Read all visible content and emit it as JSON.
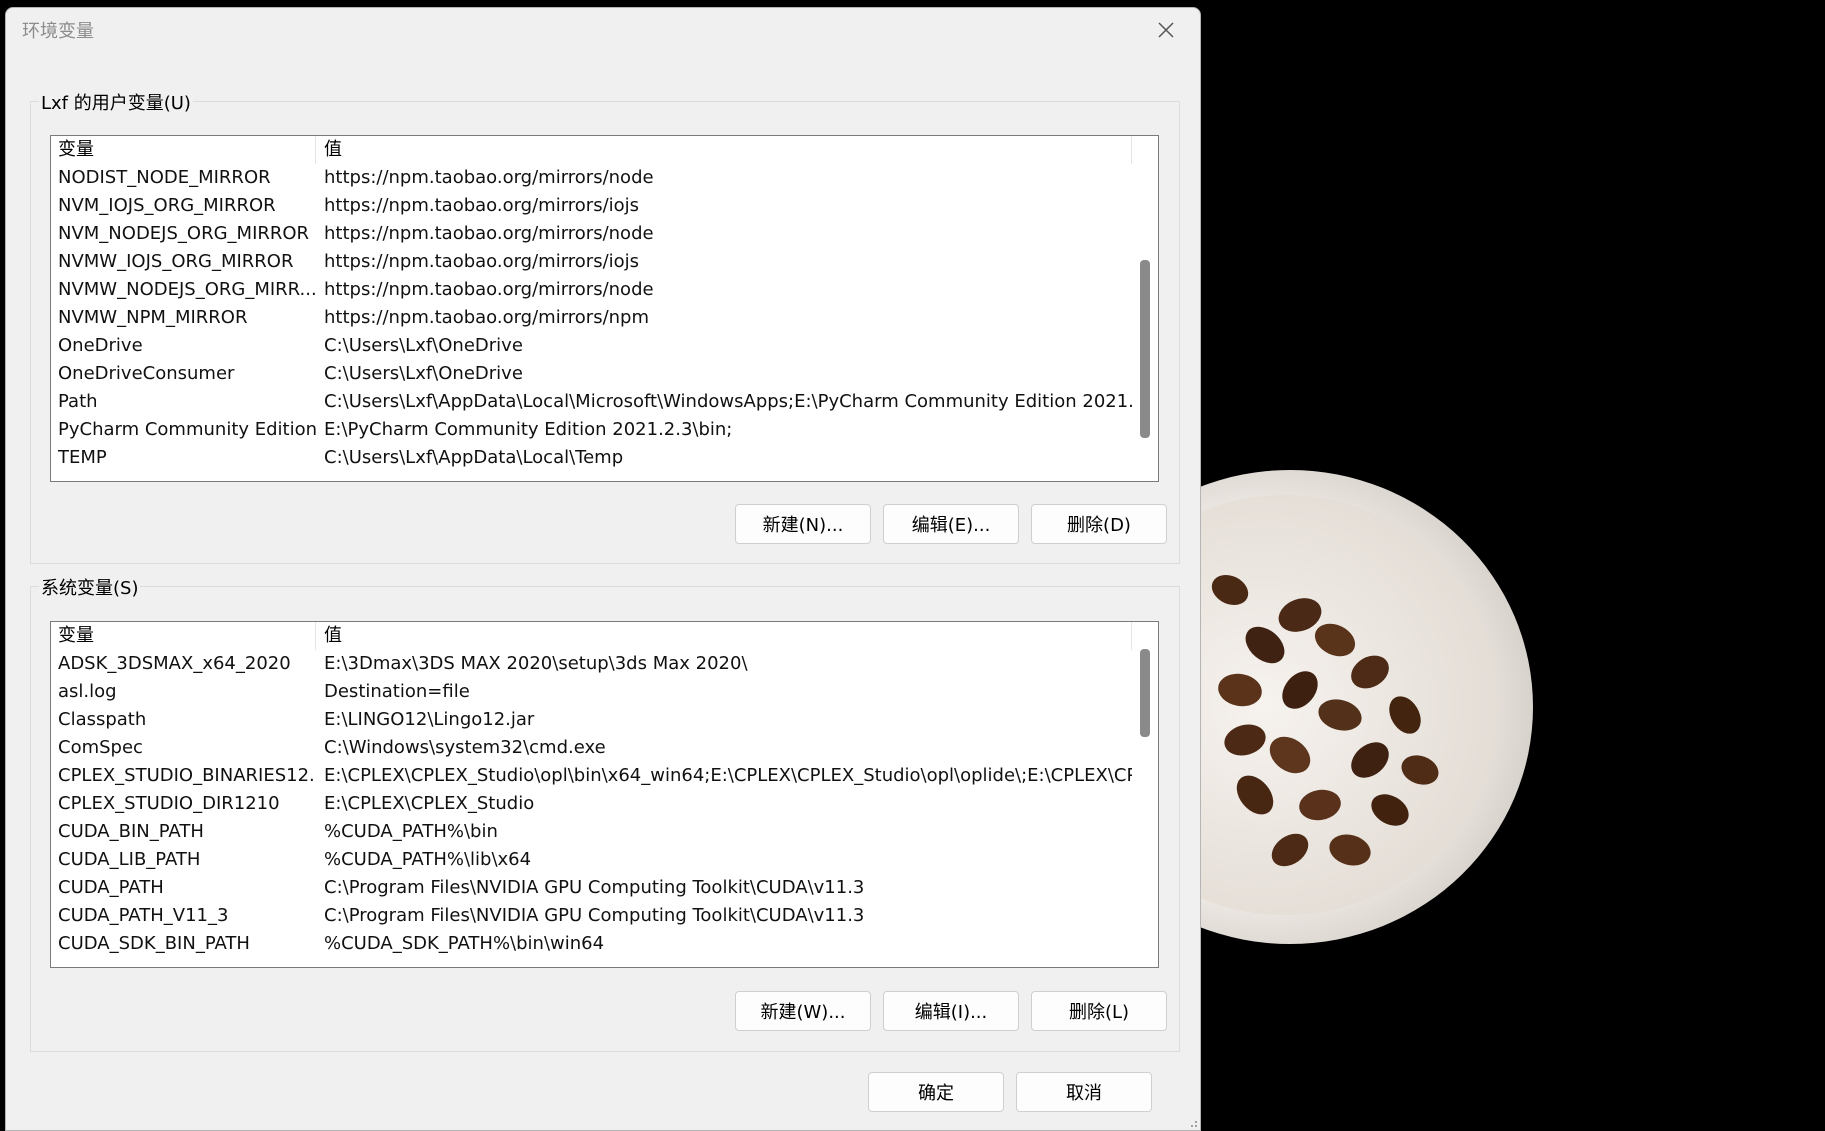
{
  "window": {
    "title": "环境变量"
  },
  "user_vars": {
    "legend": "Lxf 的用户变量(U)",
    "columns": {
      "var": "变量",
      "val": "值"
    },
    "rows": [
      {
        "var": "NODIST_NODE_MIRROR",
        "val": "https://npm.taobao.org/mirrors/node"
      },
      {
        "var": "NVM_IOJS_ORG_MIRROR",
        "val": "https://npm.taobao.org/mirrors/iojs"
      },
      {
        "var": "NVM_NODEJS_ORG_MIRROR",
        "val": "https://npm.taobao.org/mirrors/node"
      },
      {
        "var": "NVMW_IOJS_ORG_MIRROR",
        "val": "https://npm.taobao.org/mirrors/iojs"
      },
      {
        "var": "NVMW_NODEJS_ORG_MIRR...",
        "val": "https://npm.taobao.org/mirrors/node"
      },
      {
        "var": "NVMW_NPM_MIRROR",
        "val": "https://npm.taobao.org/mirrors/npm"
      },
      {
        "var": "OneDrive",
        "val": "C:\\Users\\Lxf\\OneDrive"
      },
      {
        "var": "OneDriveConsumer",
        "val": "C:\\Users\\Lxf\\OneDrive"
      },
      {
        "var": "Path",
        "val": "C:\\Users\\Lxf\\AppData\\Local\\Microsoft\\WindowsApps;E:\\PyCharm Community Edition 2021...."
      },
      {
        "var": "PyCharm Community Edition",
        "val": "E:\\PyCharm Community Edition 2021.2.3\\bin;"
      },
      {
        "var": "TEMP",
        "val": "C:\\Users\\Lxf\\AppData\\Local\\Temp"
      }
    ],
    "buttons": {
      "new": "新建(N)...",
      "edit": "编辑(E)...",
      "delete": "删除(D)"
    }
  },
  "system_vars": {
    "legend": "系统变量(S)",
    "columns": {
      "var": "变量",
      "val": "值"
    },
    "rows": [
      {
        "var": "ADSK_3DSMAX_x64_2020",
        "val": "E:\\3Dmax\\3DS MAX 2020\\setup\\3ds Max 2020\\"
      },
      {
        "var": "asl.log",
        "val": "Destination=file"
      },
      {
        "var": "Classpath",
        "val": "E:\\LINGO12\\Lingo12.jar"
      },
      {
        "var": "ComSpec",
        "val": "C:\\Windows\\system32\\cmd.exe"
      },
      {
        "var": "CPLEX_STUDIO_BINARIES12...",
        "val": "E:\\CPLEX\\CPLEX_Studio\\opl\\bin\\x64_win64;E:\\CPLEX\\CPLEX_Studio\\opl\\oplide\\;E:\\CPLEX\\CP..."
      },
      {
        "var": "CPLEX_STUDIO_DIR1210",
        "val": "E:\\CPLEX\\CPLEX_Studio"
      },
      {
        "var": "CUDA_BIN_PATH",
        "val": "%CUDA_PATH%\\bin"
      },
      {
        "var": "CUDA_LIB_PATH",
        "val": "%CUDA_PATH%\\lib\\x64"
      },
      {
        "var": "CUDA_PATH",
        "val": "C:\\Program Files\\NVIDIA GPU Computing Toolkit\\CUDA\\v11.3"
      },
      {
        "var": "CUDA_PATH_V11_3",
        "val": "C:\\Program Files\\NVIDIA GPU Computing Toolkit\\CUDA\\v11.3"
      },
      {
        "var": "CUDA_SDK_BIN_PATH",
        "val": "%CUDA_SDK_PATH%\\bin\\win64"
      }
    ],
    "buttons": {
      "new": "新建(W)...",
      "edit": "编辑(I)...",
      "delete": "删除(L)"
    }
  },
  "footer": {
    "ok": "确定",
    "cancel": "取消"
  },
  "icons": {
    "close": "close-icon",
    "resize": "resize-grip-icon"
  },
  "colors": {
    "dialog_bg": "#f0f0f0",
    "list_bg": "#ffffff",
    "desktop_bg": "#000000",
    "scrollbar": "#8a8a8a"
  }
}
